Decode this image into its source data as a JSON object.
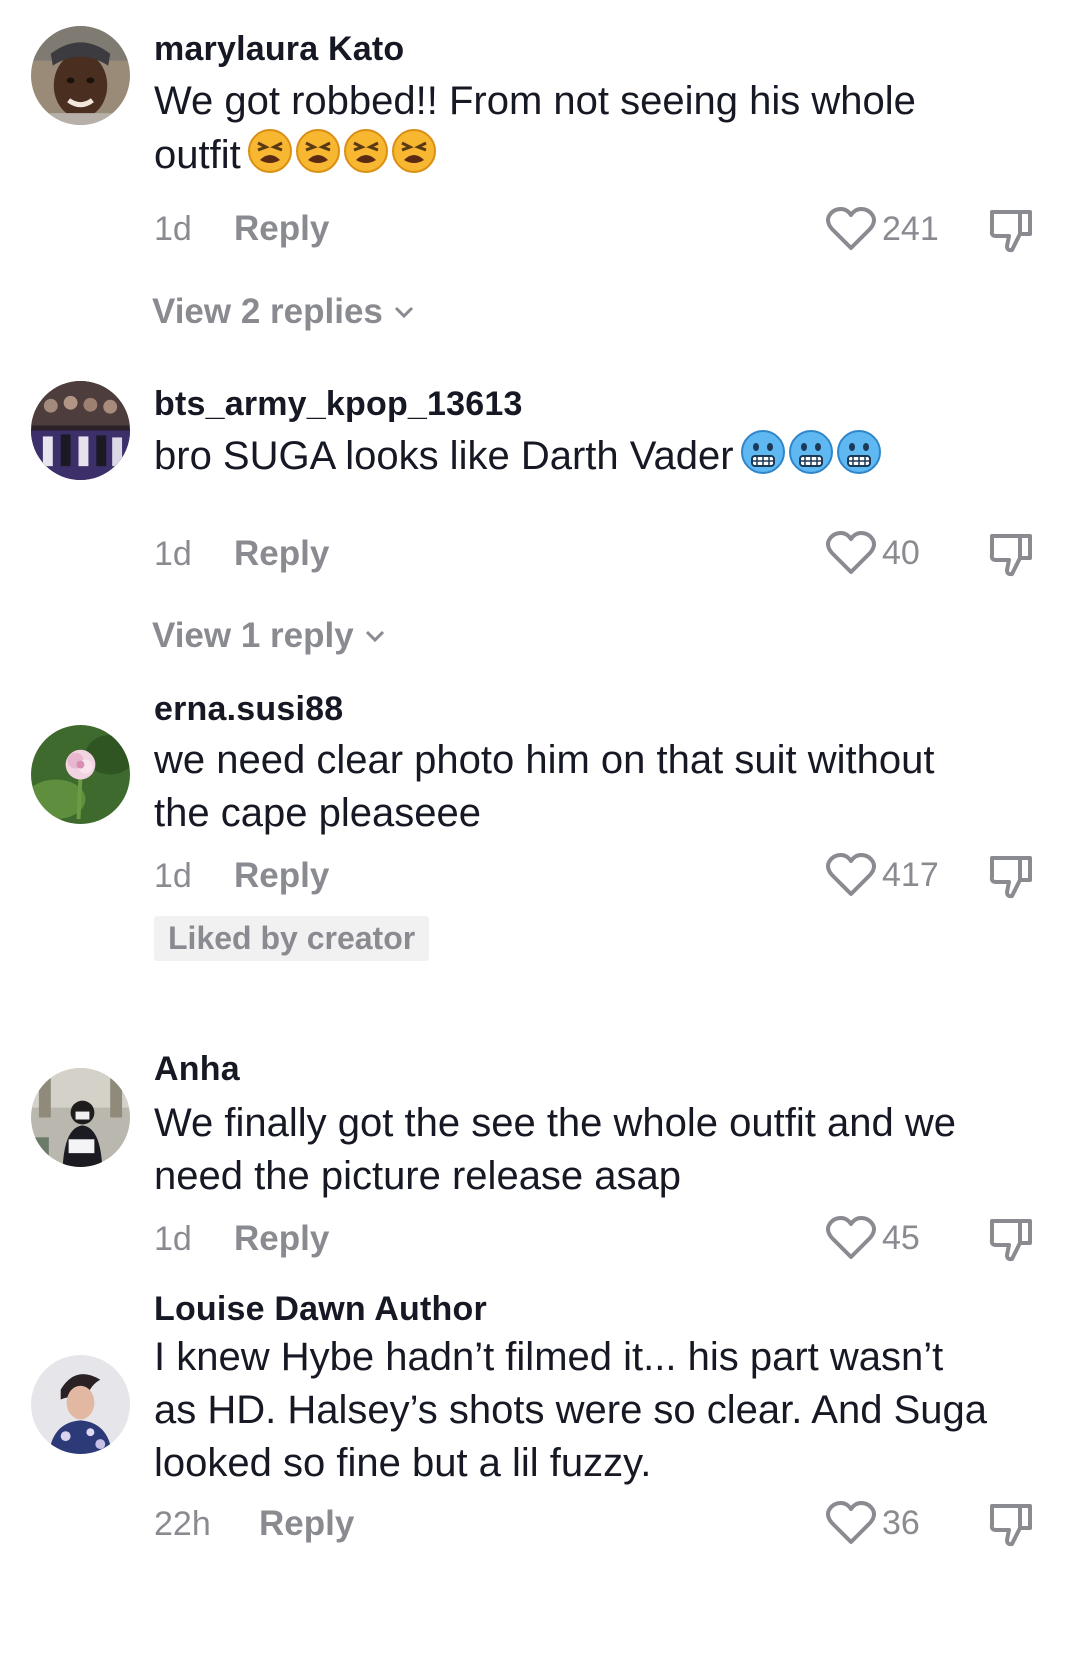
{
  "comments": [
    {
      "username": "marylaura Kato",
      "text_line1": "We got robbed!! From not seeing his whole",
      "text_line2": "outfit",
      "emoji_name": "tired-face-emoji",
      "time": "1d",
      "reply_label": "Reply",
      "likes": "241",
      "view_replies": "View 2 replies"
    },
    {
      "username": "bts_army_kpop_13613",
      "text_line1": "bro SUGA looks like Darth Vader",
      "emoji_name": "cold-face-emoji",
      "time": "1d",
      "reply_label": "Reply",
      "likes": "40",
      "view_replies": "View 1 reply"
    },
    {
      "username": "erna.susi88",
      "text_line1": "we need clear photo him on that suit without",
      "text_line2": "the cape pleaseee",
      "time": "1d",
      "reply_label": "Reply",
      "likes": "417",
      "badge": "Liked by creator"
    },
    {
      "username": "Anha",
      "text_line1": "We finally got the see the whole outfit and we",
      "text_line2": "need the picture release asap",
      "time": "1d",
      "reply_label": "Reply",
      "likes": "45"
    },
    {
      "username": "Louise Dawn Author",
      "text_line1": "I knew Hybe hadn’t filmed it... his part wasn’t",
      "text_line2": "as HD. Halsey’s shots were so clear. And Suga",
      "text_line3": "looked so fine but a lil fuzzy.",
      "time": "22h",
      "reply_label": "Reply",
      "likes": "36"
    }
  ],
  "colors": {
    "primary_text": "#161823",
    "secondary_text": "#8a8b91",
    "badge_bg": "#f1f1f2",
    "icon_stroke": "#8a8b91"
  }
}
